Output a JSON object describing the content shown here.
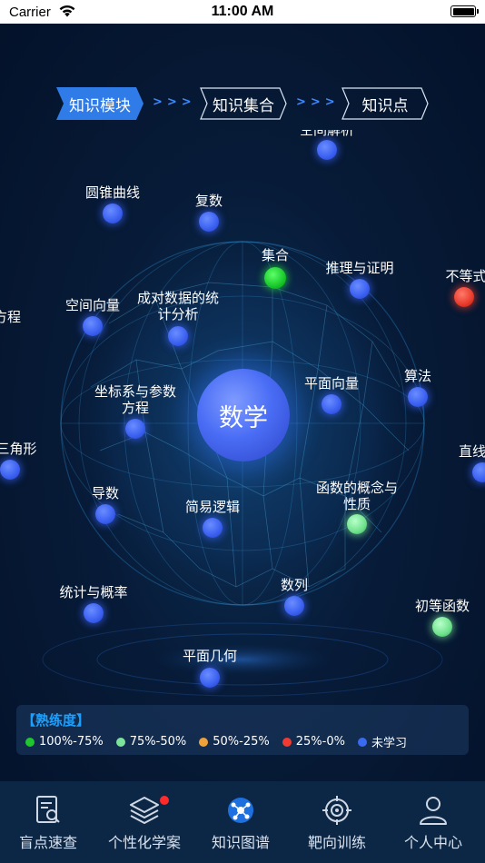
{
  "status": {
    "carrier": "Carrier",
    "time": "11:00 AM"
  },
  "breadcrumb": {
    "step1": "知识模块",
    "sep": ">>>",
    "step2": "知识集合",
    "step3": "知识点"
  },
  "center": {
    "label": "数学"
  },
  "nodes": {
    "top_partial": "空间解析",
    "conic": "圆锥曲线",
    "complex": "复数",
    "set": "集合",
    "reasoning": "推理与证明",
    "inequality": "不等式",
    "equation_partial": "方程",
    "space_vector": "空间向量",
    "paired_data": "成对数据的统计分析",
    "paired_data_l1": "成对数据的统",
    "paired_data_l2": "计分析",
    "plane_vector": "平面向量",
    "algorithm": "算法",
    "coord_param_l1": "坐标系与参数",
    "coord_param_l2": "方程",
    "triangle_partial": "三角形",
    "line_partial": "直线",
    "derivative": "导数",
    "simple_logic": "简易逻辑",
    "func_concept_l1": "函数的概念与",
    "func_concept_l2": "性质",
    "statistics": "统计与概率",
    "sequence": "数列",
    "elementary_func": "初等函数",
    "plane_geometry": "平面几何"
  },
  "legend": {
    "title": "【熟练度】",
    "items": [
      {
        "label": "100%-75%",
        "color": "#1fc62f"
      },
      {
        "label": "75%-50%",
        "color": "#7de29a"
      },
      {
        "label": "50%-25%",
        "color": "#f0a23a"
      },
      {
        "label": "25%-0%",
        "color": "#f03a32"
      },
      {
        "label": "未学习",
        "color": "#3a6af0"
      }
    ]
  },
  "tabs": [
    {
      "label": "盲点速查",
      "icon": "search-document-icon"
    },
    {
      "label": "个性化学案",
      "icon": "layers-icon"
    },
    {
      "label": "知识图谱",
      "icon": "knowledge-graph-icon"
    },
    {
      "label": "靶向训练",
      "icon": "target-icon"
    },
    {
      "label": "个人中心",
      "icon": "user-icon"
    }
  ],
  "colors": {
    "accent": "#1aa0ff",
    "background": "#04142b",
    "tabbar": "#0c2745"
  }
}
